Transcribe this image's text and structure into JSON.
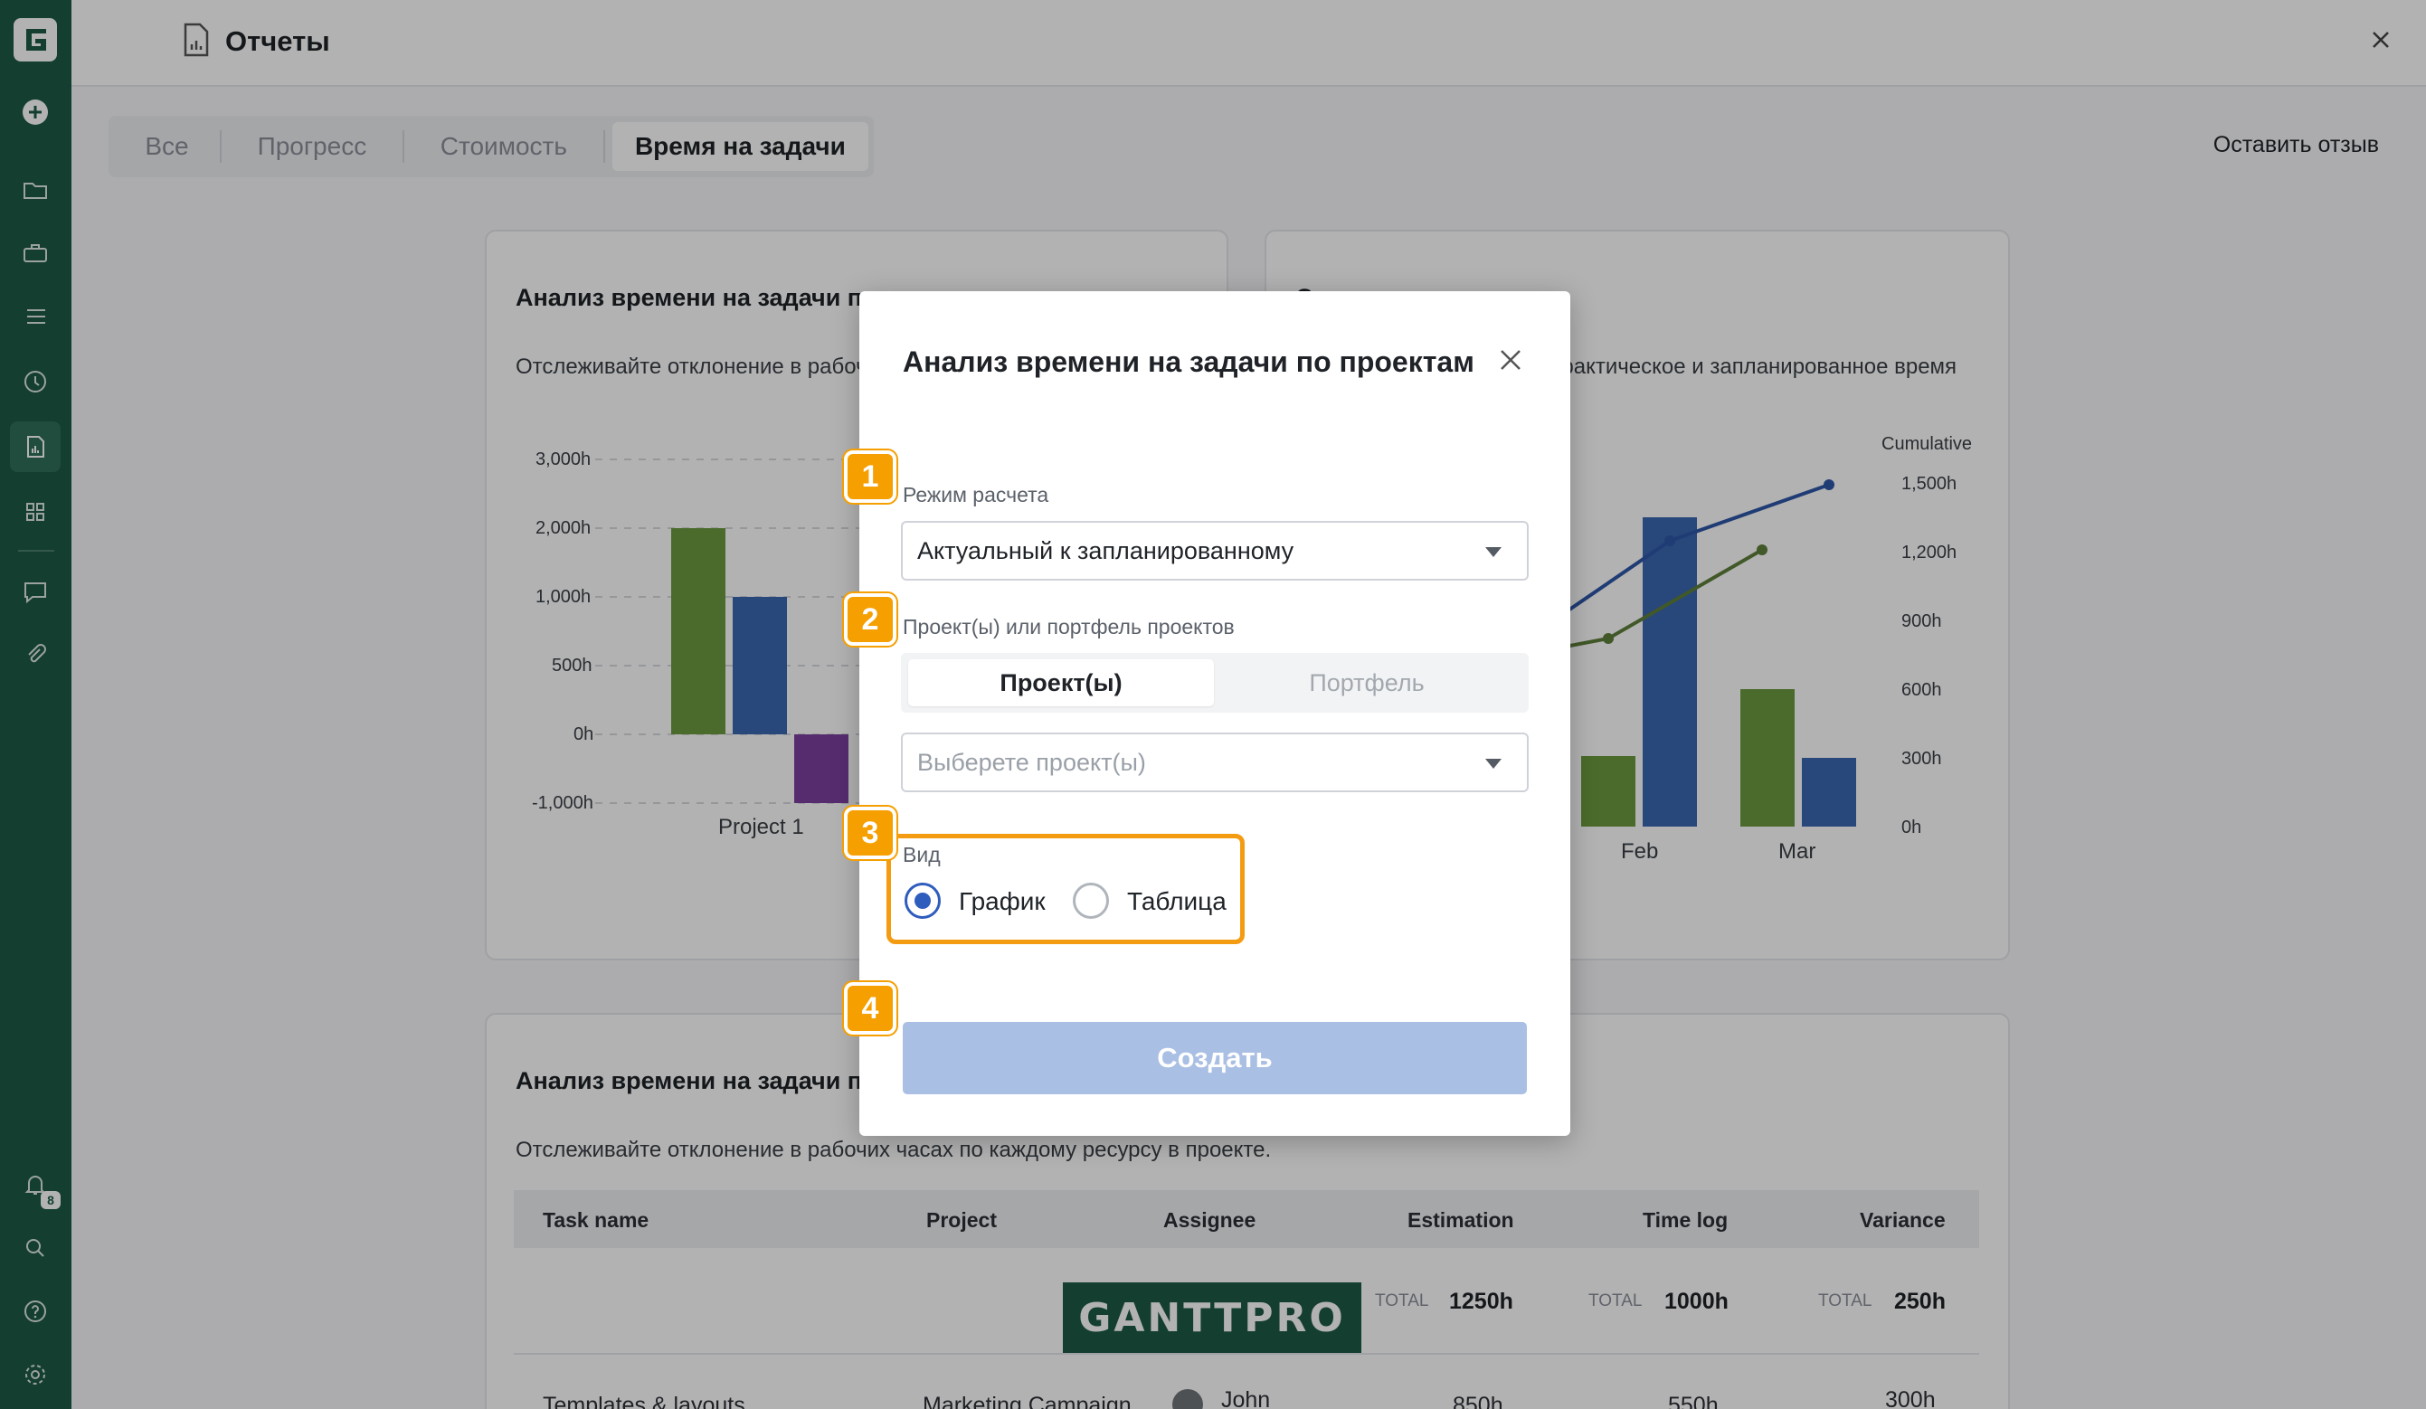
{
  "app": {
    "title": "Отчеты",
    "feedback": "Оставить отзыв",
    "notification_count": "8",
    "colors": {
      "sidebar": "#1c5a45",
      "accent": "#2f5dbd",
      "step": "#f59f00"
    }
  },
  "sidebar": {
    "icons": [
      "logo-icon",
      "plus-icon",
      "folder-icon",
      "briefcase-icon",
      "list-icon",
      "clock-icon",
      "report-icon",
      "apps-icon",
      "chat-icon",
      "paperclip-icon",
      "bell-icon",
      "search-icon",
      "help-icon",
      "gear-icon"
    ]
  },
  "tabs": [
    {
      "label": "Все",
      "active": false
    },
    {
      "label": "Прогресс",
      "active": false
    },
    {
      "label": "Стоимость",
      "active": false
    },
    {
      "label": "Время на задачи",
      "active": true
    }
  ],
  "cards": {
    "card1": {
      "title": "Анализ времени на задачи по",
      "subtitle": "Отслеживайте отклонение в рабоч",
      "y_ticks": [
        "3,000h",
        "2,000h",
        "1,000h",
        "500h",
        "0h",
        "-1,000h"
      ],
      "x_label": "Project 1"
    },
    "card2": {
      "title": "С                                          дачи",
      "subtitle": "е фактическое и запланированное время",
      "cumulative_label": "Cumulative",
      "y2_ticks": [
        "1,500h",
        "1,200h",
        "900h",
        "600h",
        "300h",
        "0h"
      ],
      "x_labels": [
        "Feb",
        "Mar"
      ]
    },
    "card3": {
      "title": "Анализ времени на задачи по",
      "subtitle": "Отслеживайте отклонение в рабочих часах по каждому ресурсу в проекте."
    }
  },
  "table": {
    "headers": [
      "Task name",
      "Project",
      "Assignee",
      "Estimation",
      "Time log",
      "Variance"
    ],
    "totals": {
      "label": "TOTAL",
      "estimation": "1250h",
      "time_log": "1000h",
      "variance": "250h"
    },
    "rows": [
      {
        "task": "Templates & layouts",
        "project": "Marketing Campaign",
        "assignee": "John",
        "estimation": "850h",
        "time_log": "550h",
        "variance": "300h"
      }
    ],
    "watermark": "GANTTPRO"
  },
  "modal": {
    "title": "Анализ времени на задачи по проектам",
    "mode_label": "Режим расчета",
    "mode_value": "Актуальный к запланированному",
    "projects_label": "Проект(ы) или портфель проектов",
    "seg_projects": "Проект(ы)",
    "seg_portfolio": "Портфель",
    "projects_placeholder": "Выберете проект(ы)",
    "view_label": "Вид",
    "view_chart": "График",
    "view_table": "Таблица",
    "view_selected": "График",
    "create": "Создать"
  },
  "steps": [
    "1",
    "2",
    "3",
    "4"
  ]
}
